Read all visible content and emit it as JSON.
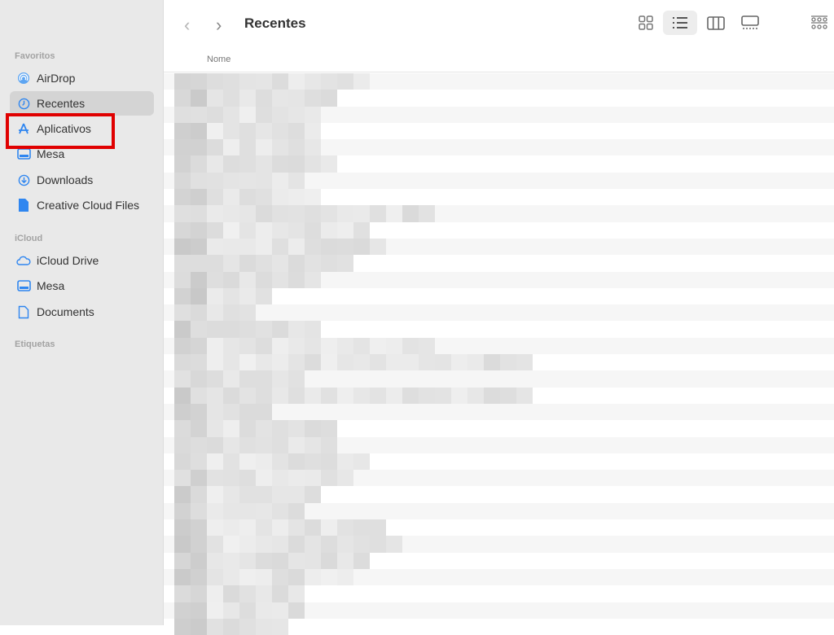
{
  "sidebar": {
    "favorites_label": "Favoritos",
    "favorites": [
      {
        "label": "AirDrop",
        "icon": "airdrop-icon"
      },
      {
        "label": "Recentes",
        "icon": "clock-icon",
        "selected": true
      },
      {
        "label": "Aplicativos",
        "icon": "applications-icon",
        "highlighted": true
      },
      {
        "label": "Mesa",
        "icon": "desktop-icon"
      },
      {
        "label": "Downloads",
        "icon": "download-icon"
      },
      {
        "label": "Creative Cloud Files",
        "icon": "file-icon"
      }
    ],
    "icloud_label": "iCloud",
    "icloud": [
      {
        "label": "iCloud Drive",
        "icon": "cloud-icon"
      },
      {
        "label": "Mesa",
        "icon": "desktop-icon"
      },
      {
        "label": "Documents",
        "icon": "document-icon"
      }
    ],
    "tags_label": "Etiquetas"
  },
  "toolbar": {
    "title": "Recentes",
    "views": [
      "icon-view",
      "list-view",
      "column-view",
      "gallery-view"
    ],
    "selected_view": "list-view",
    "group_icon": "group-icon"
  },
  "list": {
    "column_name": "Nome"
  },
  "colors": {
    "accent": "#2f86f0",
    "highlight": "#e00000"
  }
}
